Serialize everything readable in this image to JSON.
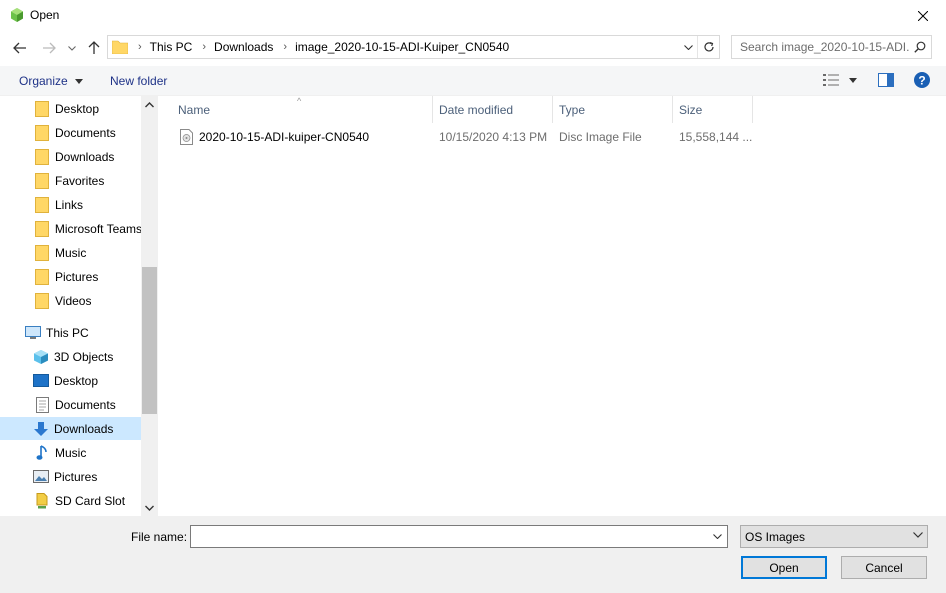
{
  "window": {
    "title": "Open"
  },
  "address": {
    "segments": [
      "This PC",
      "Downloads",
      "image_2020-10-15-ADI-Kuiper_CN0540"
    ]
  },
  "search": {
    "placeholder": "Search image_2020-10-15-ADI..."
  },
  "toolbar": {
    "organize": "Organize",
    "new_folder": "New folder"
  },
  "sidebar": {
    "items": [
      {
        "label": "Desktop",
        "icon": "folder-icon"
      },
      {
        "label": "Documents",
        "icon": "folder-icon"
      },
      {
        "label": "Downloads",
        "icon": "folder-icon"
      },
      {
        "label": "Favorites",
        "icon": "folder-icon"
      },
      {
        "label": "Links",
        "icon": "folder-icon"
      },
      {
        "label": "Microsoft Teams",
        "icon": "folder-icon"
      },
      {
        "label": "Music",
        "icon": "folder-icon"
      },
      {
        "label": "Pictures",
        "icon": "folder-icon"
      },
      {
        "label": "Videos",
        "icon": "folder-icon"
      },
      {
        "label": "This PC",
        "icon": "this-pc-icon"
      },
      {
        "label": "3D Objects",
        "icon": "3d-objects-icon"
      },
      {
        "label": "Desktop",
        "icon": "desktop-icon"
      },
      {
        "label": "Documents",
        "icon": "documents-icon"
      },
      {
        "label": "Downloads",
        "icon": "downloads-icon"
      },
      {
        "label": "Music",
        "icon": "music-icon"
      },
      {
        "label": "Pictures",
        "icon": "pictures-icon"
      },
      {
        "label": "SD Card Slot",
        "icon": "sd-card-icon"
      }
    ]
  },
  "columns": {
    "name": "Name",
    "date": "Date modified",
    "type": "Type",
    "size": "Size"
  },
  "files": [
    {
      "name": "2020-10-15-ADI-kuiper-CN0540",
      "date": "10/15/2020 4:13 PM",
      "type": "Disc Image File",
      "size": "15,558,144 ..."
    }
  ],
  "footer": {
    "file_name_label": "File name:",
    "file_name_value": "",
    "filter": "OS Images",
    "open": "Open",
    "cancel": "Cancel"
  },
  "colors": {
    "accent": "#0078d7",
    "selection": "#cce8ff",
    "link": "#1e3287",
    "folder": "#ffd766"
  }
}
